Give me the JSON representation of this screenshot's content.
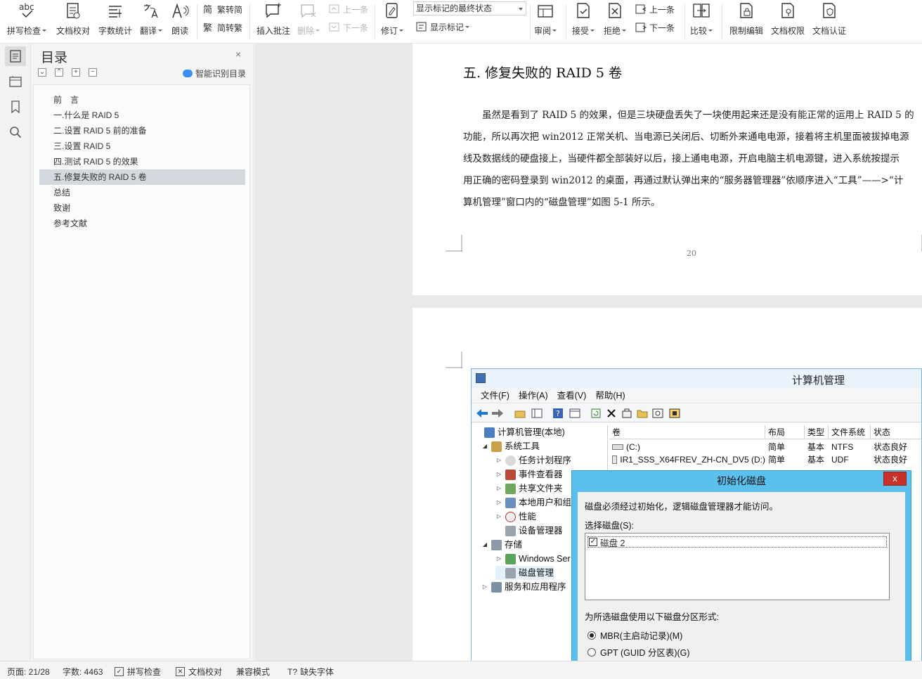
{
  "ribbon": {
    "spell_check": "拼写检查",
    "spell_icon_text": "abc",
    "doc_proof": "文档校对",
    "word_count": "字数统计",
    "translate": "翻译",
    "read_aloud": "朗读",
    "trad_to_simp": "繁转简",
    "trad_icon_text": "简",
    "simp_to_trad": "简转繁",
    "simp_icon_text": "繁",
    "insert_comment": "插入批注",
    "delete": "删除",
    "prev_comment": "上一条",
    "next_comment": "下一条",
    "track_changes": "修订",
    "display_mode_value": "显示标记的最终状态",
    "show_markup": "显示标记",
    "review": "审阅",
    "accept": "接受",
    "reject": "拒绝",
    "prev_change": "上一条",
    "next_change": "下一条",
    "compare": "比较",
    "restrict_edit": "限制编辑",
    "doc_permission": "文档权限",
    "doc_auth": "文档认证"
  },
  "toc": {
    "title": "目录",
    "close": "×",
    "smart_detect": "智能识别目录",
    "tools": [
      "⌄",
      "⌃",
      "+",
      "−"
    ],
    "items": [
      "前　言",
      "一.什么是 RAID 5",
      "二.设置 RAID 5 前的准备",
      "三.设置 RAID 5",
      "四.测试 RAID 5 的效果",
      "五.修复失败的 RAID 5 卷",
      "总结",
      "致谢",
      "参考文献"
    ],
    "active_index": 5
  },
  "document": {
    "heading": "五. 修复失败的 RAID 5 卷",
    "paragraph_lines": [
      "虽然是看到了 RAID 5 的效果，但是三块硬盘丢失了一块使用起来还是没有能正常的运用上 RAID 5 的",
      "功能，所以再次把 win2012 正常关机、当电源已关闭后、切断外来通电电源，接着将主机里面被拔掉电源",
      "线及数据线的硬盘接上，当硬件都全部装好以后，接上通电电源，开启电脑主机电源键，进入系统按提示",
      "用正确的密码登录到 win2012 的桌面，再通过默认弹出来的“服务器管理器”依顺序进入“工具”——>“计",
      "算机管理”窗口内的“磁盘管理”如图 5-1 所示。"
    ],
    "page_number": "20"
  },
  "screenshot": {
    "window_title": "计算机管理",
    "menus": [
      "文件(F)",
      "操作(A)",
      "查看(V)",
      "帮助(H)"
    ],
    "tree": {
      "root": "计算机管理(本地)",
      "system_tools": "系统工具",
      "task_scheduler": "任务计划程序",
      "event_viewer": "事件查看器",
      "shared_folders": "共享文件夹",
      "local_users": "本地用户和组",
      "performance": "性能",
      "device_manager": "设备管理器",
      "storage": "存储",
      "windows_backup": "Windows Ser",
      "disk_management": "磁盘管理",
      "services_apps": "服务和应用程序"
    },
    "columns": [
      "卷",
      "布局",
      "类型",
      "文件系统",
      "状态"
    ],
    "rows": [
      [
        "(C:)",
        "简单",
        "基本",
        "NTFS",
        "状态良好"
      ],
      [
        "IR1_SSS_X64FREV_ZH-CN_DV5 (D:)",
        "简单",
        "基本",
        "UDF",
        "状态良好"
      ]
    ],
    "dialog": {
      "title": "初始化磁盘",
      "close": "x",
      "intro": "磁盘必须经过初始化，逻辑磁盘管理器才能访问。",
      "select_label": "选择磁盘(S):",
      "disk_item": "磁盘 2",
      "disk_checked": "✓",
      "partition_label": "为所选磁盘使用以下磁盘分区形式:",
      "mbr": "MBR(主启动记录)(M)",
      "gpt": "GPT (GUID 分区表)(G)",
      "selected": "MBR"
    }
  },
  "status": {
    "page": "页面: 21/28",
    "words": "字数: 4463",
    "spell_check": "拼写检查",
    "doc_proof": "文档校对",
    "compat_mode": "兼容模式",
    "missing_fonts": "缺失字体"
  },
  "colors": {
    "accent_blue": "#3b8ff0",
    "dialog_frame": "#5cc0ee",
    "close_red": "#c7312a",
    "toc_active": "#d4d9df"
  }
}
